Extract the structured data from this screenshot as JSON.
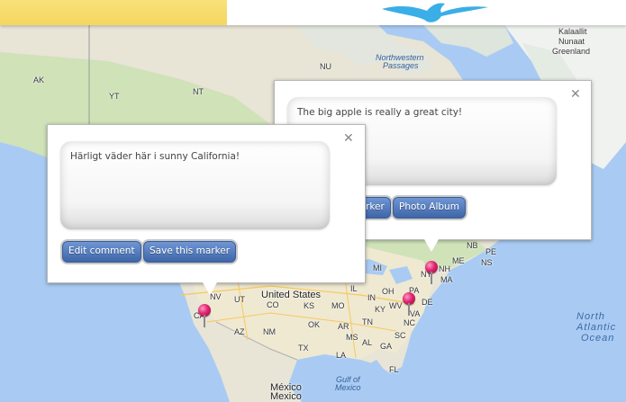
{
  "map": {
    "labels": {
      "ak": "AK",
      "yt": "YT",
      "nt": "NT",
      "nu": "NU",
      "northwest_passages_1": "Northwestern",
      "northwest_passages_2": "Passages",
      "greenland_1": "Kalaallit",
      "greenland_2": "Nunaat",
      "greenland_3": "Greenland",
      "nb": "NB",
      "pe": "PE",
      "ns": "NS",
      "me": "ME",
      "nh": "NH",
      "ny": "NY",
      "ma": "MA",
      "mi": "MI",
      "pa": "PA",
      "oh": "OH",
      "il": "IL",
      "in": "IN",
      "de": "DE",
      "wv": "WV",
      "va": "VA",
      "ks": "KS",
      "mo": "MO",
      "ky": "KY",
      "ut": "UT",
      "co": "CO",
      "nv": "NV",
      "ca": "CA",
      "az": "AZ",
      "nm": "NM",
      "ok": "OK",
      "ar": "AR",
      "tn": "TN",
      "nc": "NC",
      "sc": "SC",
      "ga": "GA",
      "ms": "MS",
      "al": "AL",
      "tx": "TX",
      "la": "LA",
      "fl": "FL",
      "united_states": "United States",
      "gulf_1": "Gulf of",
      "gulf_2": "Mexico",
      "mexico_1": "México",
      "mexico_2": "Mexico",
      "north_atlantic_1": "North",
      "north_atlantic_2": "Atlantic",
      "north_atlantic_3": "Ocean"
    }
  },
  "info_window_ca": {
    "comment": "Härligt väder här i sunny California!",
    "edit_label": "Edit comment",
    "save_label": "Save this marker",
    "close_glyph": "✕"
  },
  "info_window_ny": {
    "comment": "The big apple is really a great city!",
    "partial_label": "rker",
    "album_label": "Photo Album",
    "close_glyph": "✕"
  }
}
